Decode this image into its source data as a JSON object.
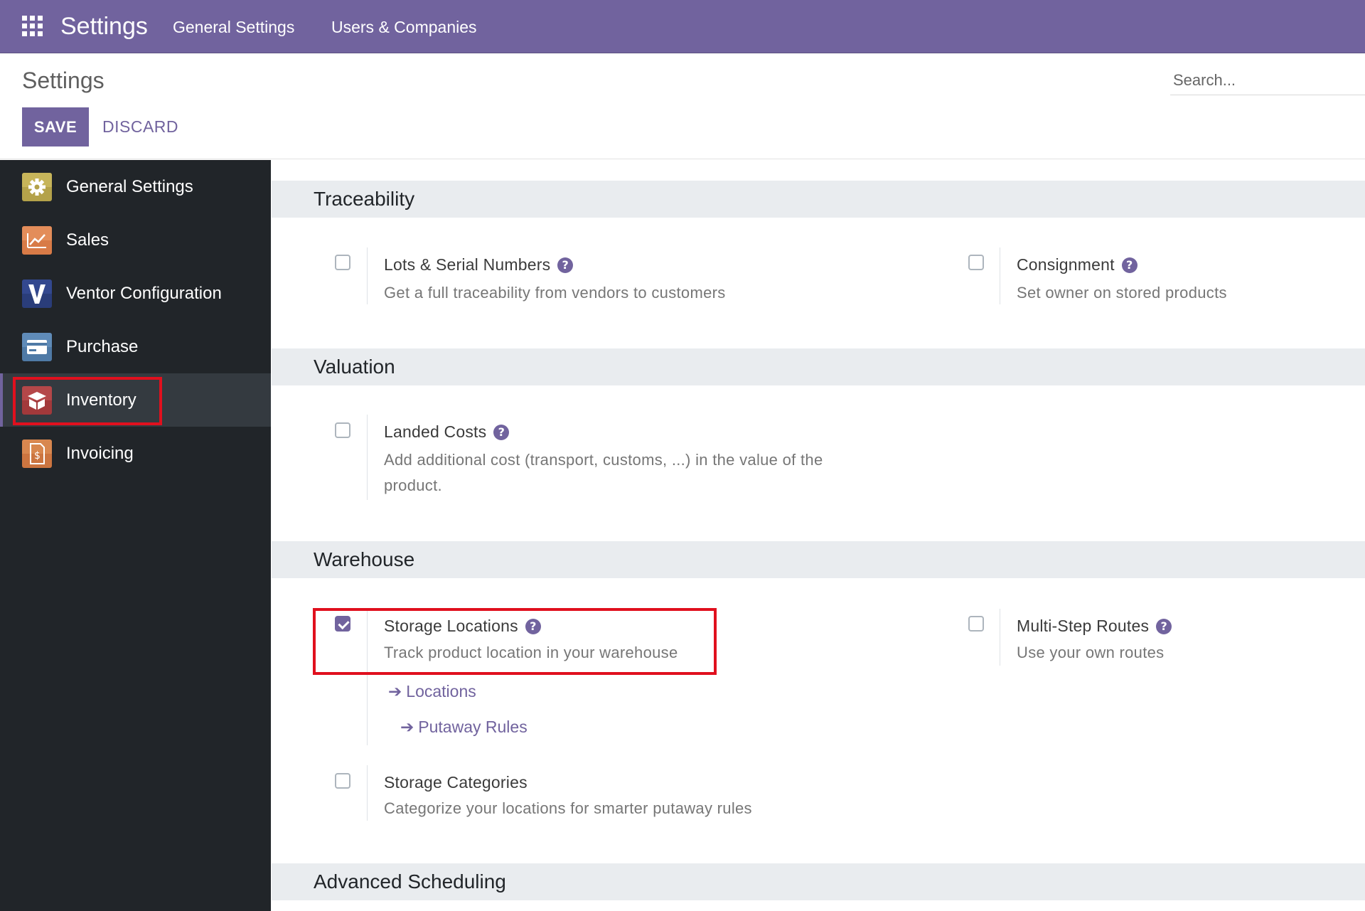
{
  "navbar": {
    "brand": "Settings",
    "menu": [
      "General Settings",
      "Users & Companies"
    ]
  },
  "control_panel": {
    "title": "Settings",
    "save_label": "SAVE",
    "discard_label": "DISCARD",
    "search_placeholder": "Search..."
  },
  "sidebar": {
    "items": [
      {
        "label": "General Settings",
        "icon": "gear-icon",
        "active": false
      },
      {
        "label": "Sales",
        "icon": "chart-icon",
        "active": false
      },
      {
        "label": "Ventor Configuration",
        "icon": "ventor-v-icon",
        "active": false
      },
      {
        "label": "Purchase",
        "icon": "credit-card-icon",
        "active": false
      },
      {
        "label": "Inventory",
        "icon": "box-icon",
        "active": true
      },
      {
        "label": "Invoicing",
        "icon": "invoice-icon",
        "active": false
      }
    ]
  },
  "sections": {
    "traceability": {
      "title": "Traceability",
      "lots": {
        "label": "Lots & Serial Numbers",
        "desc": "Get a full traceability from vendors to customers",
        "checked": false
      },
      "consignment": {
        "label": "Consignment",
        "desc": "Set owner on stored products",
        "checked": false
      }
    },
    "valuation": {
      "title": "Valuation",
      "landed": {
        "label": "Landed Costs",
        "desc": "Add additional cost (transport, customs, ...) in the value of the product.",
        "checked": false
      }
    },
    "warehouse": {
      "title": "Warehouse",
      "storage_locations": {
        "label": "Storage Locations",
        "desc": "Track product location in your warehouse",
        "checked": true
      },
      "links": {
        "locations": "Locations",
        "putaway": "Putaway Rules"
      },
      "multi_step": {
        "label": "Multi-Step Routes",
        "desc": "Use your own routes",
        "checked": false
      },
      "storage_categories": {
        "label": "Storage Categories",
        "desc": "Categorize your locations for smarter putaway rules",
        "checked": false
      }
    },
    "advanced": {
      "title": "Advanced Scheduling"
    }
  },
  "help_glyph": "?",
  "arrow_glyph": "➔",
  "colors": {
    "brand": "#71639e",
    "sidebar": "#212529",
    "highlight": "#e0101e"
  }
}
